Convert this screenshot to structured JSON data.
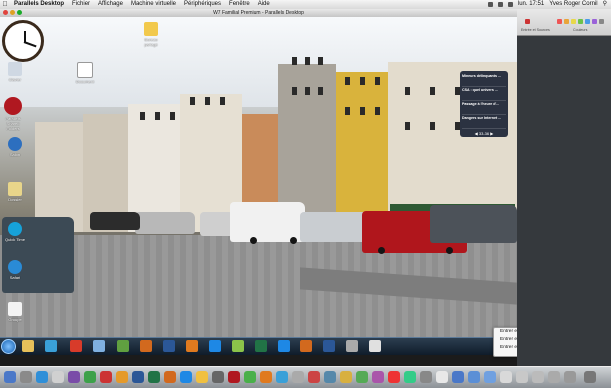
{
  "menubar": {
    "apple": "",
    "app_name": "Parallels Desktop",
    "items": [
      "Fichier",
      "Affichage",
      "Machine virtuelle",
      "Périphériques",
      "Fenêtre",
      "Aide"
    ],
    "clock": "lun. 17:51",
    "user": "Yves Roger Cornil"
  },
  "window": {
    "title": "W7 Familial Premium - Parallels Desktop"
  },
  "desktop_icons": [
    {
      "label": "Parallels Shared Folders",
      "icon": "folder-icon"
    },
    {
      "label": "Salon",
      "icon": "app-icon"
    },
    {
      "label": "Safari",
      "icon": "safari-icon"
    },
    {
      "label": "Quick Time",
      "icon": "quicktime-icon"
    },
    {
      "label": "Dossier",
      "icon": "folder-icon"
    },
    {
      "label": "Document",
      "icon": "document-icon"
    },
    {
      "label": "Bureau partagé",
      "icon": "folder-icon"
    },
    {
      "label": "Clavier",
      "icon": "keyboard-icon"
    },
    {
      "label": "Groupe",
      "icon": "app-icon"
    }
  ],
  "gadget": {
    "headlines": [
      "Mineurs délinquants ...",
      "CSA : quel univers ...",
      "Passage à l'heure d'...",
      "Dangers sur Internet ..."
    ],
    "pager": "33-36"
  },
  "context_menu": {
    "items": [
      "Entrer en mode Coherence",
      "Entrer en mode Plein écran",
      "Entrer en mode Modality"
    ]
  },
  "sidepanel": {
    "labels": [
      "Entrée et Sources",
      "Couleurs"
    ]
  },
  "taskbar": {
    "clock": "17:51"
  },
  "colors": {
    "taskbar": "#0f1c2a",
    "dock": "#8c9196",
    "menubar": "#e8e8e8"
  }
}
